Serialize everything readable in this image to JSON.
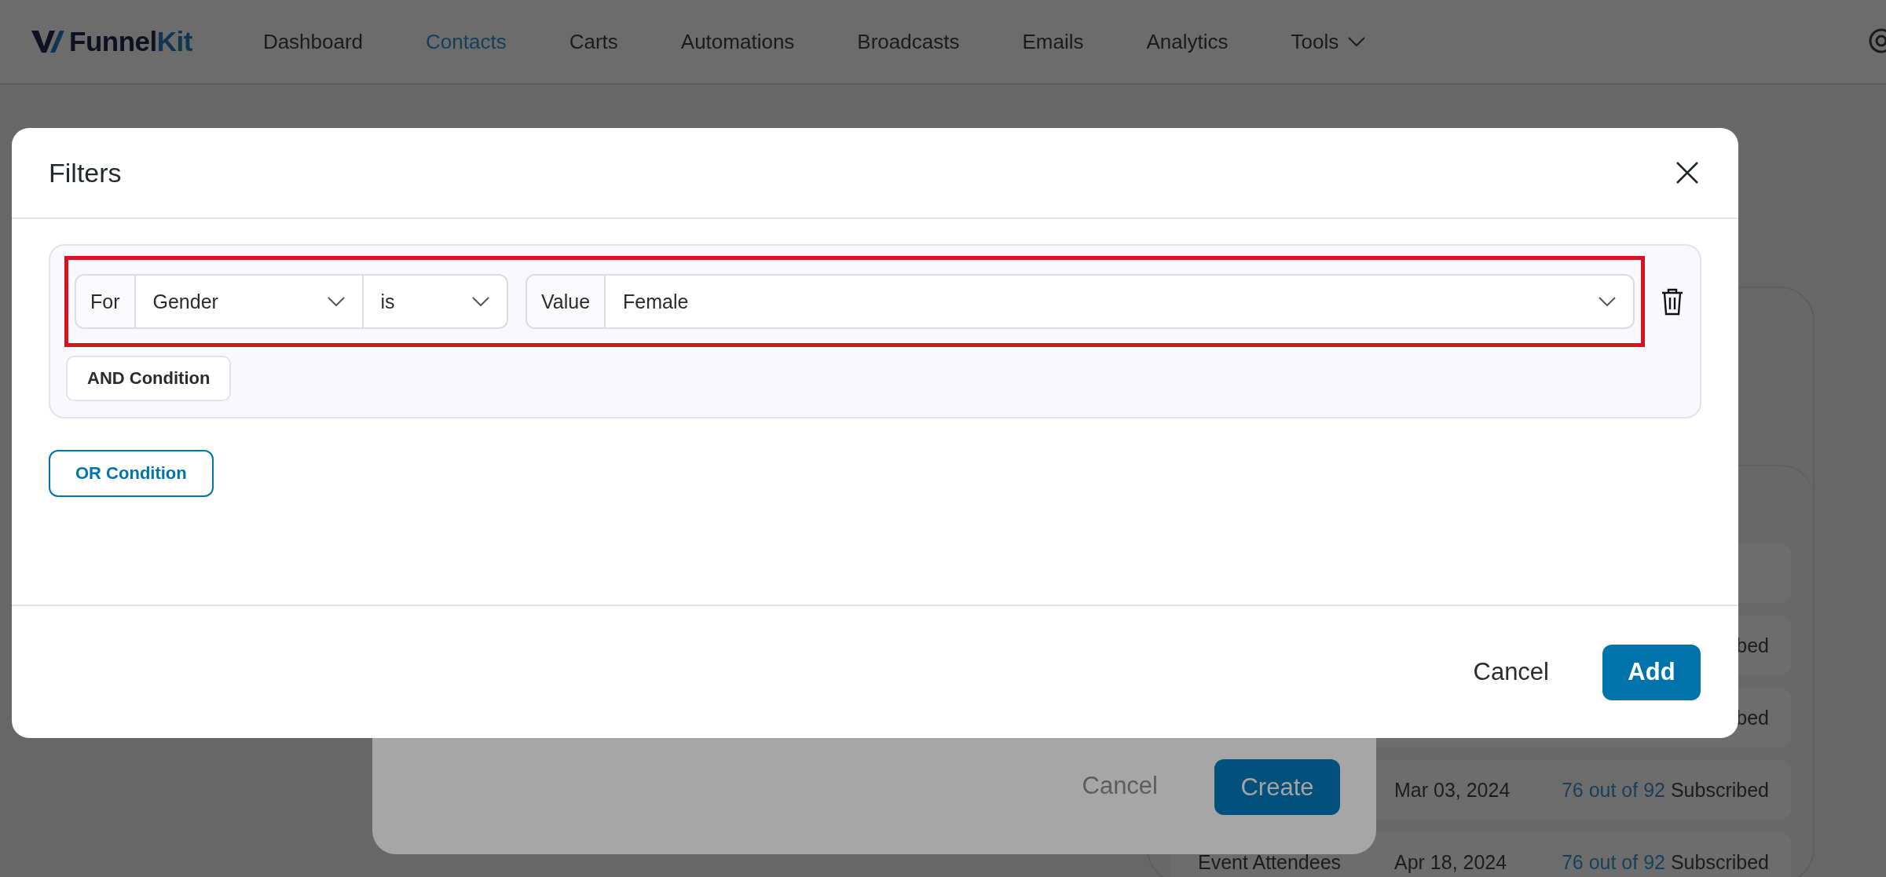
{
  "nav": {
    "logo": {
      "text": "Funnel",
      "accent": "Kit"
    },
    "items": [
      {
        "label": "Dashboard",
        "selected": false
      },
      {
        "label": "Contacts",
        "selected": true
      },
      {
        "label": "Carts",
        "selected": false
      },
      {
        "label": "Automations",
        "selected": false
      },
      {
        "label": "Broadcasts",
        "selected": false
      },
      {
        "label": "Emails",
        "selected": false
      },
      {
        "label": "Analytics",
        "selected": false
      },
      {
        "label": "Tools",
        "selected": false,
        "dropdown": true
      }
    ]
  },
  "background_list": {
    "rows": [
      {},
      {
        "status": "bed"
      },
      {
        "status": "bed"
      },
      {
        "date": "Mar 03, 2024",
        "count": "76 out of 92",
        "status": "Subscribed"
      },
      {
        "name": "Event Attendees",
        "date": "Apr 18, 2024",
        "count": "76 out of 92",
        "status": "Subscribed"
      }
    ]
  },
  "background_dialog": {
    "cancel": "Cancel",
    "create": "Create"
  },
  "filters_modal": {
    "title": "Filters",
    "groups": [
      {
        "conditions": [
          {
            "for_label": "For",
            "field": "Gender",
            "operator": "is",
            "value_label": "Value",
            "value": "Female",
            "highlighted": true
          }
        ],
        "and_button": "AND Condition"
      }
    ],
    "or_button": "OR Condition",
    "cancel": "Cancel",
    "add": "Add"
  }
}
